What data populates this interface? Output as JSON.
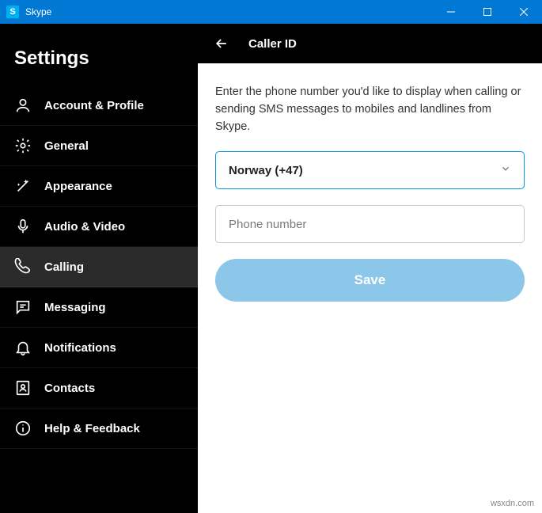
{
  "window": {
    "app_name": "Skype"
  },
  "sidebar": {
    "title": "Settings",
    "items": [
      {
        "label": "Account & Profile"
      },
      {
        "label": "General"
      },
      {
        "label": "Appearance"
      },
      {
        "label": "Audio & Video"
      },
      {
        "label": "Calling"
      },
      {
        "label": "Messaging"
      },
      {
        "label": "Notifications"
      },
      {
        "label": "Contacts"
      },
      {
        "label": "Help & Feedback"
      }
    ]
  },
  "main": {
    "title": "Caller ID",
    "description": "Enter the phone number you'd like to display when calling or sending SMS messages to mobiles and landlines from Skype.",
    "country_value": "Norway (+47)",
    "phone_placeholder": "Phone number",
    "save_label": "Save"
  },
  "watermark": "wsxdn.com"
}
